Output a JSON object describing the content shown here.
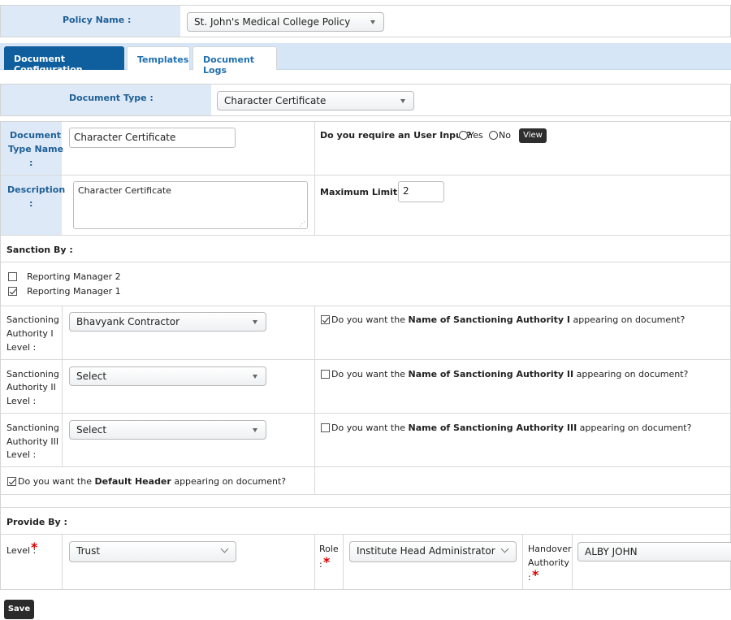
{
  "policy": {
    "label": "Policy Name :",
    "selected": "St. John's Medical College Policy"
  },
  "tabs": [
    {
      "label": "Document Configuration",
      "active": true
    },
    {
      "label": "Templates",
      "active": false
    },
    {
      "label": "Document Logs",
      "active": false
    }
  ],
  "document_type": {
    "label": "Document Type :",
    "selected": "Character Certificate"
  },
  "doc_type_name": {
    "label_1": "Document",
    "label_2": "Type Name",
    "label_3": ":",
    "value": "Character Certificate"
  },
  "user_input": {
    "question": "Do you require an User Input?",
    "yes": "Yes",
    "no": "No",
    "view_button": "View"
  },
  "description": {
    "label_1": "Description",
    "label_2": ":",
    "value": "Character Certificate"
  },
  "max_limit": {
    "label": "Maximum Limit :",
    "value": "2"
  },
  "sanction": {
    "title": "Sanction By :",
    "managers": [
      {
        "label": "Reporting Manager 2",
        "checked": false
      },
      {
        "label": "Reporting Manager 1",
        "checked": true
      }
    ],
    "rows": [
      {
        "l1": "Sanctioning",
        "l2": "Authority I",
        "l3": "Level :",
        "selected": "Bhavyank Contractor",
        "q_pre": "Do you want the ",
        "q_bold": "Name of Sanctioning Authority I",
        "q_post": " appearing on document?",
        "checked": true
      },
      {
        "l1": "Sanctioning",
        "l2": "Authority II",
        "l3": "Level :",
        "selected": "Select",
        "q_pre": "Do you want the ",
        "q_bold": "Name of Sanctioning Authority II",
        "q_post": " appearing on document?",
        "checked": false
      },
      {
        "l1": "Sanctioning",
        "l2": "Authority III",
        "l3": "Level :",
        "selected": "Select",
        "q_pre": "Do you want the ",
        "q_bold": "Name of Sanctioning Authority III",
        "q_post": " appearing on document?",
        "checked": false
      }
    ]
  },
  "default_header": {
    "pre": "Do you want the ",
    "bold": "Default Header",
    "post": " appearing on document?",
    "checked": true
  },
  "provide": {
    "title": "Provide By :",
    "level_label": "Level :",
    "level_value": "Trust",
    "role_label": "Role",
    "role_colon": ":",
    "role_value": "Institute Head Administrator",
    "handover_label_1": "Handover",
    "handover_label_2": "Authority",
    "handover_colon": ":",
    "handover_value": "ALBY JOHN",
    "required_mark": "*"
  },
  "save_button": "Save"
}
